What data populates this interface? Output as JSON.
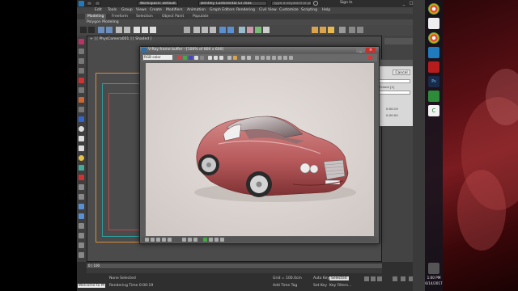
{
  "app": {
    "workspace_label": "Workspace: Default",
    "file_name": "Bentley Continental GT.max",
    "search_placeholder": "Type a keyword or phrase",
    "sign_in": "Sign In",
    "menus": [
      "Edit",
      "Tools",
      "Group",
      "Views",
      "Create",
      "Modifiers",
      "Animation",
      "Graph Editors",
      "Rendering",
      "Civil View",
      "Customize",
      "Scripting",
      "Help"
    ],
    "ribbon_tabs": [
      "Modeling",
      "Freeform",
      "Selection",
      "Object Paint",
      "Populate"
    ],
    "ribbon_sub": "Polygon Modeling",
    "toolbar_dropdown": "View",
    "viewport_label": "+ ] [ PhysCamera001 ] [ Shaded ]"
  },
  "vfb": {
    "title": "V-Ray frame buffer - [100% of 800 x 600]",
    "channel": "RGB color",
    "min": "_",
    "close": "×"
  },
  "dialog": {
    "cancel": "Cancel",
    "lines": [
      "Frame [1]",
      "0:00:19",
      "0:00:00"
    ]
  },
  "status": {
    "selected": "None Selected",
    "rendering_time": "Rendering Time 0:00:19",
    "welcome": "Welcome to M",
    "grid": "Grid = 100.0cm",
    "add_time_tag": "Add Time Tag",
    "auto_key": "Auto Key",
    "selected_dropdown": "Selected",
    "set_key": "Set Key",
    "key_filters": "Key Filters...",
    "frame_counter": "0 / 100"
  },
  "system": {
    "time": "1:00 PM",
    "date": "6/14/2017"
  },
  "colors": {
    "car_body": "#b85a5c",
    "render_bg": "#dcd6d2",
    "close_red": "#c9302c",
    "desktop_red": "#7a1b20"
  }
}
